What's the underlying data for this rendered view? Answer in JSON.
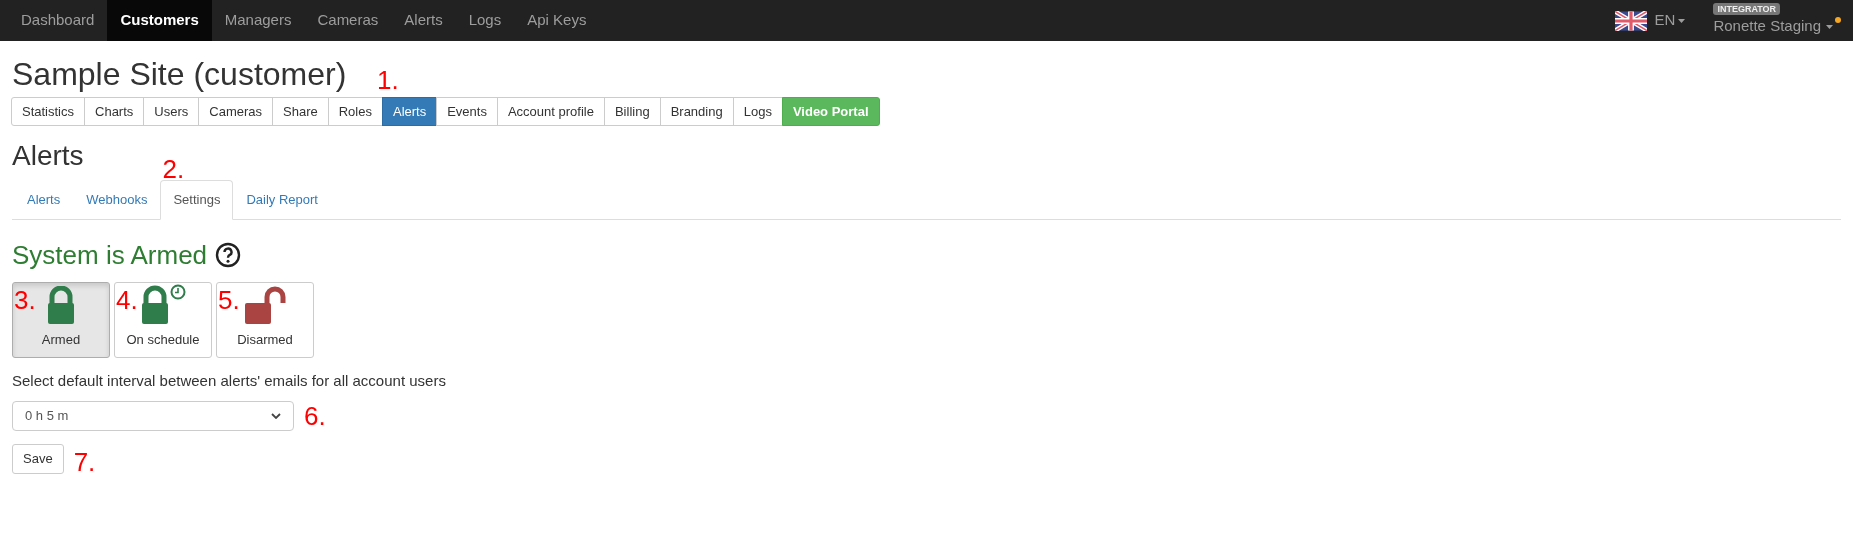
{
  "navbar": {
    "items": [
      {
        "label": "Dashboard",
        "selected": false
      },
      {
        "label": "Customers",
        "selected": true
      },
      {
        "label": "Managers",
        "selected": false
      },
      {
        "label": "Cameras",
        "selected": false
      },
      {
        "label": "Alerts",
        "selected": false
      },
      {
        "label": "Logs",
        "selected": false
      },
      {
        "label": "Api Keys",
        "selected": false
      }
    ],
    "language": "EN",
    "role_badge": "INTEGRATOR",
    "user": "Ronette Staging",
    "notification_dot": true
  },
  "page_title": "Sample Site (customer)",
  "section_tabs": [
    {
      "label": "Statistics",
      "selected": false,
      "kind": "tab"
    },
    {
      "label": "Charts",
      "selected": false,
      "kind": "tab"
    },
    {
      "label": "Users",
      "selected": false,
      "kind": "tab"
    },
    {
      "label": "Cameras",
      "selected": false,
      "kind": "tab"
    },
    {
      "label": "Share",
      "selected": false,
      "kind": "tab"
    },
    {
      "label": "Roles",
      "selected": false,
      "kind": "tab"
    },
    {
      "label": "Alerts",
      "selected": true,
      "kind": "tab",
      "annotation": "1."
    },
    {
      "label": "Events",
      "selected": false,
      "kind": "tab"
    },
    {
      "label": "Account profile",
      "selected": false,
      "kind": "tab"
    },
    {
      "label": "Billing",
      "selected": false,
      "kind": "tab"
    },
    {
      "label": "Branding",
      "selected": false,
      "kind": "tab"
    },
    {
      "label": "Logs",
      "selected": false,
      "kind": "tab"
    },
    {
      "label": "Video Portal",
      "kind": "portal"
    }
  ],
  "section_title": "Alerts",
  "sub_tabs": [
    {
      "label": "Alerts",
      "selected": false
    },
    {
      "label": "Webhooks",
      "selected": false
    },
    {
      "label": "Settings",
      "selected": true,
      "annotation": "2."
    },
    {
      "label": "Daily Report",
      "selected": false
    }
  ],
  "status_heading": "System is Armed",
  "modes": [
    {
      "label": "Armed",
      "kind": "armed",
      "selected": true,
      "annotation": "3."
    },
    {
      "label": "On schedule",
      "kind": "schedule",
      "selected": false,
      "annotation": "4."
    },
    {
      "label": "Disarmed",
      "kind": "disarmed",
      "selected": false,
      "annotation": "5."
    }
  ],
  "interval": {
    "label": "Select default interval between alerts' emails for all account users",
    "value": "0 h 5 m",
    "annotation": "6."
  },
  "save_button": {
    "label": "Save",
    "annotation": "7."
  }
}
